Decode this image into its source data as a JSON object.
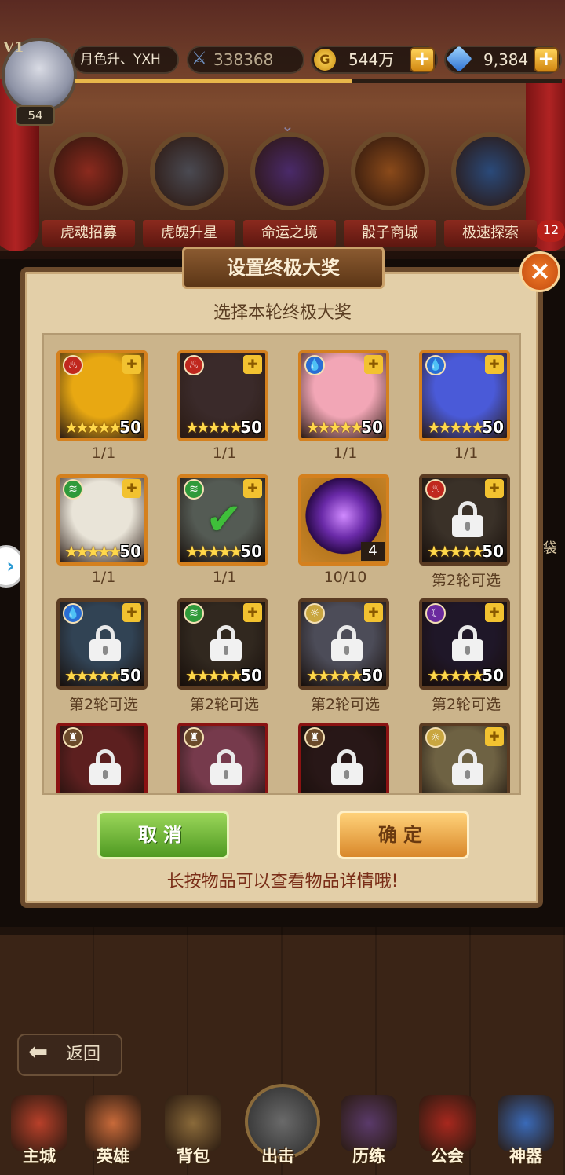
{
  "player": {
    "vip": "V1",
    "level": "54",
    "name": "月色升、YXH",
    "power": "338368",
    "gold": "544万",
    "gems": "9,384",
    "gold_symbol": "G",
    "plus": "+"
  },
  "features": [
    {
      "label": "虎魂招募",
      "color": "#8b2a1e"
    },
    {
      "label": "虎魄升星",
      "color": "#4a4a52"
    },
    {
      "label": "命运之境",
      "color": "#4a2a6a"
    },
    {
      "label": "骰子商城",
      "color": "#8a4a1a"
    },
    {
      "label": "极速探索",
      "color": "#2a4a7a"
    }
  ],
  "notification_count": "12",
  "modal": {
    "title": "设置终极大奖",
    "subtitle": "选择本轮终极大奖",
    "close": "×",
    "cancel": "取消",
    "confirm": "确定",
    "hint": "长按物品可以查看物品详情哦!"
  },
  "rewards": [
    {
      "element": "fire",
      "art": "#e8a812",
      "stars": "★★★★★",
      "level": "50",
      "label": "1/1",
      "locked": false
    },
    {
      "element": "fire",
      "art": "#3a2a2a",
      "stars": "★★★★★",
      "level": "50",
      "label": "1/1",
      "locked": false
    },
    {
      "element": "water",
      "art": "#f2a6b6",
      "stars": "★★★★★",
      "level": "50",
      "label": "1/1",
      "locked": false
    },
    {
      "element": "water",
      "art": "#4a5ad8",
      "stars": "★★★★★",
      "level": "50",
      "label": "1/1",
      "locked": false
    },
    {
      "element": "wind",
      "art": "#e9e4d8",
      "stars": "★★★★★",
      "level": "50",
      "label": "1/1",
      "locked": false
    },
    {
      "element": "wind",
      "art": "#9aa69a",
      "stars": "★★★★★",
      "level": "50",
      "label": "1/1",
      "locked": false,
      "checked": true
    },
    {
      "element": "",
      "art": "#6a2aa8",
      "qty": "4",
      "label": "10/10",
      "locked": false,
      "item": true
    },
    {
      "element": "fire",
      "art": "#6a5a4a",
      "stars": "★★★★★",
      "level": "50",
      "label": "第2轮可选",
      "locked": true
    },
    {
      "element": "water",
      "art": "#5a7a9a",
      "stars": "★★★★★",
      "level": "50",
      "label": "第2轮可选",
      "locked": true
    },
    {
      "element": "wind",
      "art": "#5a4a3a",
      "stars": "★★★★★",
      "level": "50",
      "label": "第2轮可选",
      "locked": true
    },
    {
      "element": "light",
      "art": "#8a8aa0",
      "stars": "★★★★★",
      "level": "50",
      "label": "第2轮可选",
      "locked": true
    },
    {
      "element": "dark",
      "art": "#3a2a4a",
      "stars": "★★★★★",
      "level": "50",
      "label": "第2轮可选",
      "locked": true
    },
    {
      "element": "neutral",
      "art": "#a83a3a",
      "label": "",
      "locked": true,
      "red": true
    },
    {
      "element": "neutral",
      "art": "#d86a8a",
      "label": "",
      "locked": true,
      "red": true
    },
    {
      "element": "neutral",
      "art": "#4a2a2a",
      "label": "",
      "locked": true,
      "red": true
    },
    {
      "element": "light",
      "art": "#c9b27a",
      "label": "",
      "locked": true
    }
  ],
  "side_text": "袋",
  "back": "返回",
  "nav": [
    {
      "label": "主城",
      "color": "#b8402a"
    },
    {
      "label": "英雄",
      "color": "#c86a3a"
    },
    {
      "label": "背包",
      "color": "#8a6a3a"
    },
    {
      "label": "出击",
      "color": "#4a4a4a"
    },
    {
      "label": "历练",
      "color": "#5a3a6a"
    },
    {
      "label": "公会",
      "color": "#a8281e"
    },
    {
      "label": "神器",
      "color": "#3a6ab8"
    }
  ]
}
